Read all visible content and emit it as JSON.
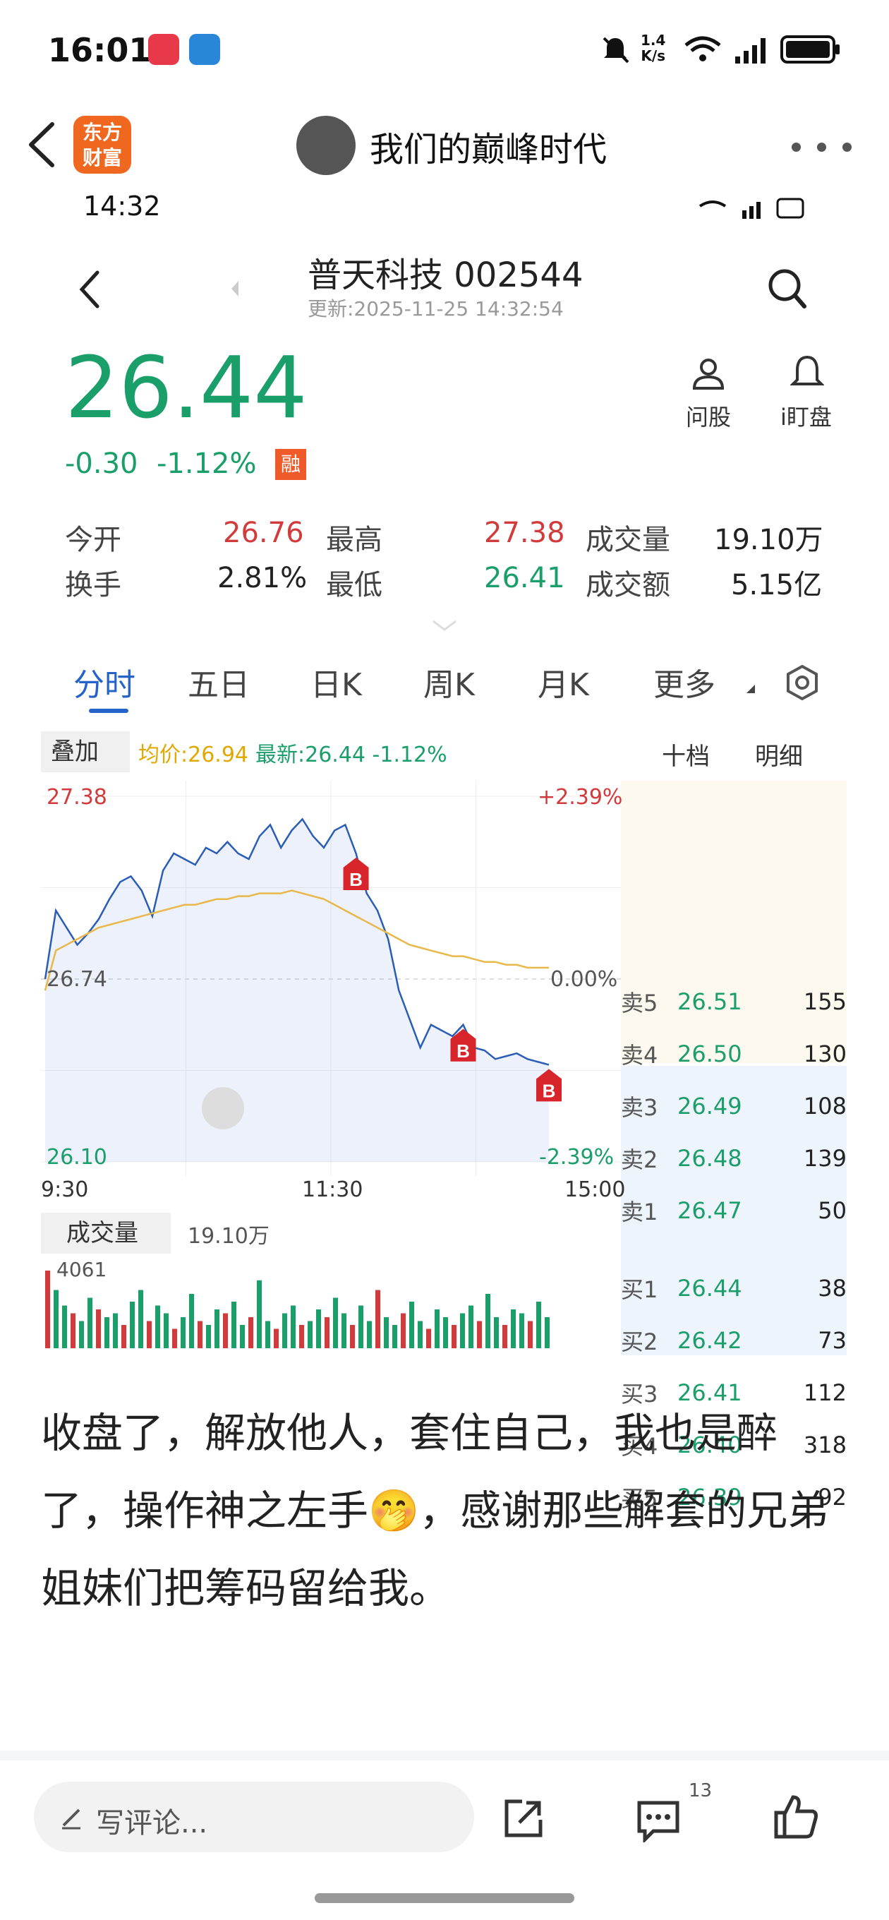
{
  "status": {
    "time": "16:01",
    "net_speed_top": "1.4",
    "net_speed_bottom": "K/s",
    "signal": "6"
  },
  "nav": {
    "app_badge_line1": "东方",
    "app_badge_line2": "财富",
    "title": "我们的巅峰时代"
  },
  "shot": {
    "status_time": "14:32",
    "stock_name": "普天科技 002544",
    "updated": "更新:2025-11-25 14:32:54",
    "price": "26.44",
    "change": "-0.30",
    "change_pct": "-1.12%",
    "rong": "融",
    "ask_label": "问股",
    "watch_label": "i盯盘",
    "stats": {
      "open_label": "今开",
      "open": "26.76",
      "high_label": "最高",
      "high": "27.38",
      "volume_label": "成交量",
      "volume": "19.10万",
      "turnover_label": "换手",
      "turnover": "2.81%",
      "low_label": "最低",
      "low": "26.41",
      "amount_label": "成交额",
      "amount": "5.15亿"
    },
    "tabs": [
      "分时",
      "五日",
      "日K",
      "周K",
      "月K",
      "更多"
    ],
    "overlay_label": "叠加",
    "avg_price": "均价:26.94",
    "latest": "最新:26.44 -1.12%",
    "book_tabs": [
      "十档",
      "明细"
    ],
    "sell": [
      {
        "label": "卖5",
        "price": "26.51",
        "vol": "155"
      },
      {
        "label": "卖4",
        "price": "26.50",
        "vol": "130"
      },
      {
        "label": "卖3",
        "price": "26.49",
        "vol": "108"
      },
      {
        "label": "卖2",
        "price": "26.48",
        "vol": "139"
      },
      {
        "label": "卖1",
        "price": "26.47",
        "vol": "50"
      }
    ],
    "buy": [
      {
        "label": "买1",
        "price": "26.44",
        "vol": "38"
      },
      {
        "label": "买2",
        "price": "26.42",
        "vol": "73"
      },
      {
        "label": "买3",
        "price": "26.41",
        "vol": "112"
      },
      {
        "label": "买4",
        "price": "26.40",
        "vol": "318"
      },
      {
        "label": "买5",
        "price": "26.39",
        "vol": "92"
      }
    ],
    "volume_tab": "成交量",
    "volume_total": "19.10万",
    "chart_data": {
      "type": "line",
      "y_left_ticks": [
        "27.38",
        "26.74",
        "26.10"
      ],
      "y_right_ticks": [
        "+2.39%",
        "0.00%",
        "-2.39%"
      ],
      "x_ticks": [
        "9:30",
        "11:30",
        "15:00"
      ],
      "ylim": [
        26.1,
        27.38
      ],
      "series": [
        {
          "values": [
            26.74,
            26.98,
            26.92,
            26.86,
            26.9,
            26.95,
            27.02,
            27.08,
            27.1,
            27.05,
            26.96,
            27.12,
            27.18,
            27.16,
            27.14,
            27.2,
            27.18,
            27.22,
            27.18,
            27.16,
            27.24,
            27.28,
            27.2,
            27.26,
            27.3,
            27.24,
            27.2,
            27.26,
            27.28,
            27.18,
            27.04,
            26.98,
            26.88,
            26.7,
            26.6,
            26.5,
            26.58,
            26.56,
            26.54,
            26.58,
            26.5,
            26.49,
            26.46,
            26.47,
            26.48,
            26.46,
            26.45,
            26.44
          ]
        },
        {
          "values": [
            26.7,
            26.84,
            26.86,
            26.88,
            26.9,
            26.92,
            26.93,
            26.94,
            26.95,
            26.96,
            26.97,
            26.98,
            26.99,
            27.0,
            27.0,
            27.01,
            27.02,
            27.02,
            27.03,
            27.03,
            27.04,
            27.04,
            27.04,
            27.05,
            27.04,
            27.03,
            27.02,
            27.0,
            26.98,
            26.96,
            26.94,
            26.92,
            26.9,
            26.88,
            26.86,
            26.85,
            26.84,
            26.83,
            26.82,
            26.82,
            26.81,
            26.8,
            26.8,
            26.79,
            26.79,
            26.78,
            26.78,
            26.78
          ]
        }
      ],
      "buy_markers": [
        29,
        39,
        47
      ],
      "volume_max_label": "4061",
      "volumes": [
        40,
        30,
        22,
        18,
        14,
        26,
        20,
        16,
        18,
        12,
        24,
        30,
        14,
        22,
        18,
        10,
        16,
        28,
        14,
        12,
        20,
        18,
        24,
        12,
        16,
        35,
        14,
        10,
        18,
        22,
        12,
        14,
        20,
        16,
        26,
        18,
        12,
        22,
        14,
        30,
        16,
        12,
        18,
        24,
        14,
        10,
        20,
        16,
        12,
        18,
        22,
        14,
        28,
        16,
        12,
        20,
        18,
        14,
        24,
        16
      ]
    },
    "post_text": "收盘了，解放他人，套住自己，我也是醉了，操作神之左手🤭，感谢那些解套的兄弟姐妹们把筹码留给我。",
    "comment_placeholder": "写评论...",
    "comment_count": "13"
  }
}
